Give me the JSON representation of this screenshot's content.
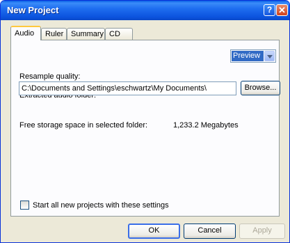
{
  "window": {
    "title": "New Project",
    "help_glyph": "?",
    "close_glyph": "✕"
  },
  "tabs": [
    "Audio",
    "Ruler",
    "Summary",
    "CD"
  ],
  "audio": {
    "resample_label": "Resample quality:",
    "resample_value": "Preview",
    "folder_label": "Extracted audio folder:",
    "folder_value": "C:\\Documents and Settings\\eschwartz\\My Documents\\",
    "browse_label": "Browse...",
    "free_space_label": "Free storage space in selected folder:",
    "free_space_value": "1,233.2 Megabytes",
    "checkbox_label": "Start all new projects with these settings"
  },
  "footer": {
    "ok": "OK",
    "cancel": "Cancel",
    "apply": "Apply"
  }
}
